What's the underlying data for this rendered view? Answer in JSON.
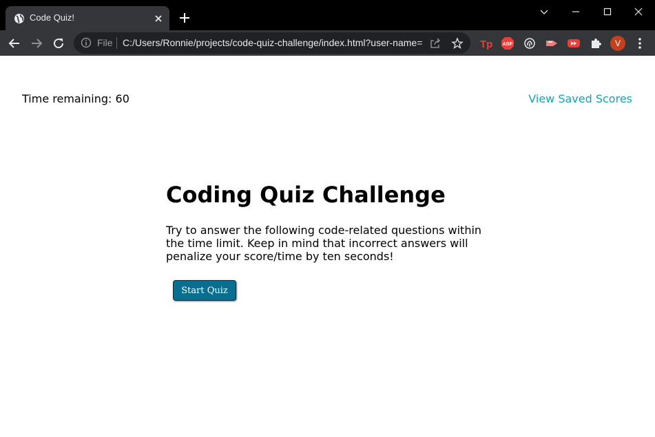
{
  "browser": {
    "tab_title": "Code Quiz!",
    "address_scheme_label": "File",
    "address_url": "C:/Users/Ronnie/projects/code-quiz-challenge/index.html?user-name=",
    "profile_initial": "V",
    "extensions": [
      "tp-extension-icon",
      "adblock-plus-icon",
      "fingerprint-extension-icon",
      "video-extension-icon",
      "youtube-extension-icon",
      "puzzle-icon"
    ]
  },
  "header": {
    "timer_label": "Time remaining: 60",
    "scores_link": "View Saved Scores"
  },
  "intro": {
    "title": "Coding Quiz Challenge",
    "description": "Try to answer the following code-related questions within the time limit. Keep in mind that incorrect answers will penalize your score/time by ten seconds!",
    "start_button": "Start Quiz"
  },
  "colors": {
    "link": "#17a2b8",
    "button": "#0a6f8f",
    "avatar": "#c5401c"
  }
}
